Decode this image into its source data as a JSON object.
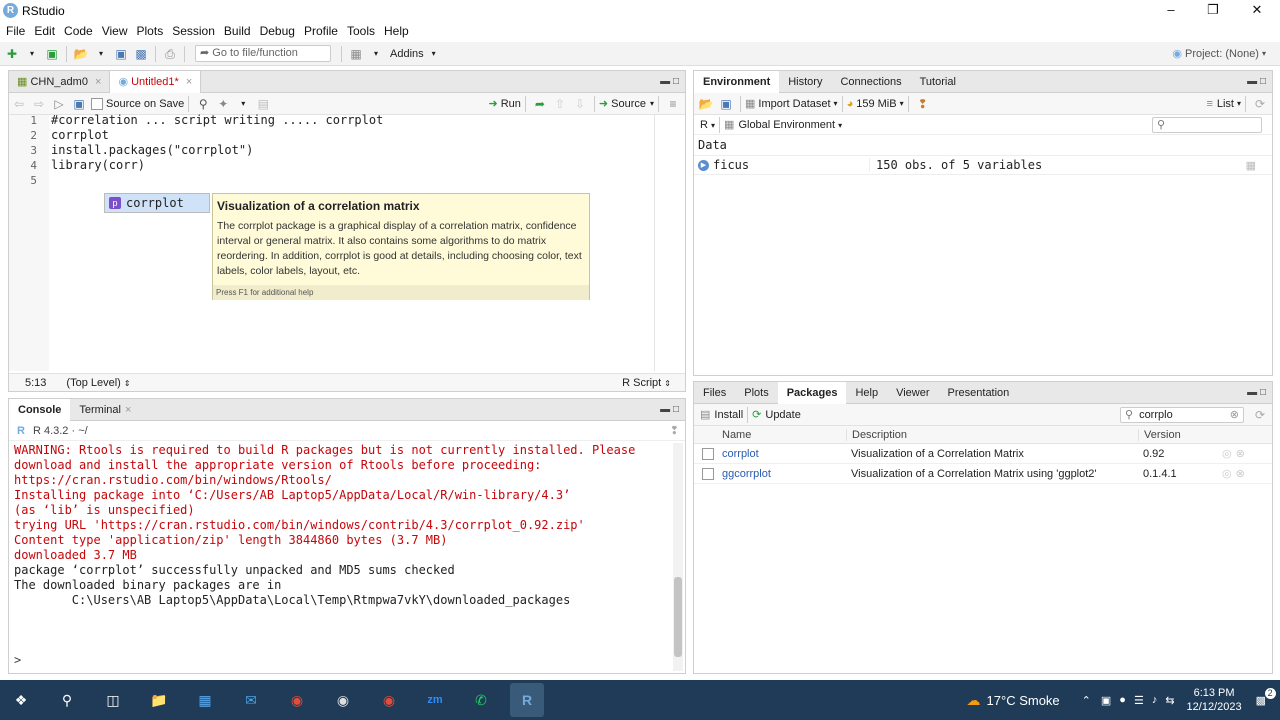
{
  "window": {
    "title": "RStudio"
  },
  "menu": [
    "File",
    "Edit",
    "Code",
    "View",
    "Plots",
    "Session",
    "Build",
    "Debug",
    "Profile",
    "Tools",
    "Help"
  ],
  "toolbar": {
    "goto_placeholder": "Go to file/function",
    "addins": "Addins",
    "project": "Project: (None)"
  },
  "editor": {
    "tabs": [
      {
        "label": "CHN_adm0"
      },
      {
        "label": "Untitled1*"
      }
    ],
    "source_on_save": "Source on Save",
    "run": "Run",
    "source": "Source",
    "lines": [
      {
        "num": "1",
        "text": "#correlation ... script writing ..... corrplot"
      },
      {
        "num": "2",
        "text": ""
      },
      {
        "num": "3",
        "text": "corrplot"
      },
      {
        "num": "4",
        "text": "install.packages(\"corrplot\")"
      },
      {
        "num": "5",
        "text": "library(corr)"
      }
    ],
    "status": {
      "position": "5:13",
      "scope": "(Top Level)",
      "type": "R Script"
    }
  },
  "autocomplete": {
    "item": "corrplot",
    "item_badge": "p",
    "tip_title": "Visualization of a correlation matrix",
    "tip_body": "The corrplot package is a graphical display of a correlation matrix, confidence interval or general matrix. It also contains some algorithms to do matrix reordering. In addition, corrplot is good at details, including choosing color, text labels, color labels, layout, etc.",
    "tip_footer": "Press F1 for additional help"
  },
  "environment": {
    "tabs": [
      "Environment",
      "History",
      "Connections",
      "Tutorial"
    ],
    "import_dataset": "Import Dataset",
    "memory": "159 MiB",
    "list_mode": "List",
    "lang": "R",
    "scope": "Global Environment",
    "section": "Data",
    "rows": [
      {
        "name": "ficus",
        "value": "150 obs. of 5 variables"
      }
    ]
  },
  "console": {
    "tabs": [
      "Console",
      "Terminal"
    ],
    "r_version": "R 4.3.2 · ~/",
    "lines": [
      {
        "text": "WARNING: Rtools is required to build R packages but is not currently installed. Please",
        "warn": true
      },
      {
        "text": "download and install the appropriate version of Rtools before proceeding:",
        "warn": true
      },
      {
        "text": "",
        "warn": true
      },
      {
        "text": "https://cran.rstudio.com/bin/windows/Rtools/",
        "warn": true
      },
      {
        "text": "Installing package into ‘C:/Users/AB Laptop5/AppData/Local/R/win-library/4.3’",
        "warn": true
      },
      {
        "text": "(as ‘lib’ is unspecified)",
        "warn": true
      },
      {
        "text": "trying URL 'https://cran.rstudio.com/bin/windows/contrib/4.3/corrplot_0.92.zip'",
        "warn": true
      },
      {
        "text": "Content type 'application/zip' length 3844860 bytes (3.7 MB)",
        "warn": true
      },
      {
        "text": "downloaded 3.7 MB",
        "warn": true
      },
      {
        "text": "",
        "warn": false
      },
      {
        "text": "package ‘corrplot’ successfully unpacked and MD5 sums checked",
        "warn": false
      },
      {
        "text": "",
        "warn": false
      },
      {
        "text": "The downloaded binary packages are in",
        "warn": false
      },
      {
        "text": "        C:\\Users\\AB Laptop5\\AppData\\Local\\Temp\\Rtmpwa7vkY\\downloaded_packages",
        "warn": false
      }
    ],
    "prompt": ">"
  },
  "packages": {
    "tabs": [
      "Files",
      "Plots",
      "Packages",
      "Help",
      "Viewer",
      "Presentation"
    ],
    "install": "Install",
    "update": "Update",
    "search_value": "corrplo",
    "headers": [
      "Name",
      "Description",
      "Version"
    ],
    "rows": [
      {
        "name": "corrplot",
        "desc": "Visualization of a Correlation Matrix",
        "version": "0.92"
      },
      {
        "name": "ggcorrplot",
        "desc": "Visualization of a Correlation Matrix using 'ggplot2'",
        "version": "0.1.4.1"
      }
    ]
  },
  "taskbar": {
    "weather": "17°C  Smoke",
    "time": "6:13 PM",
    "date": "12/12/2023",
    "notif": "2"
  },
  "colors": {
    "accent": "#75aadb",
    "warn": "#c5060b",
    "taskbar": "#1f3b57",
    "link": "#2a5db0"
  }
}
